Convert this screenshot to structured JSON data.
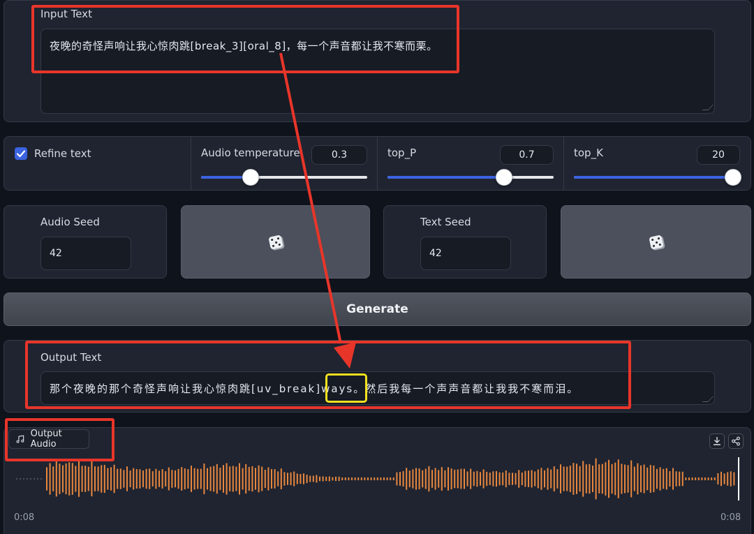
{
  "input": {
    "label": "Input Text",
    "value": "夜晚的奇怪声响让我心惊肉跳[break_3][oral_8]，每一个声音都让我不寒而栗。"
  },
  "controls": {
    "refine": {
      "label": "Refine text",
      "checked": true
    },
    "audio_temperature": {
      "label": "Audio temperature",
      "value": "0.3",
      "fraction": 0.3
    },
    "top_p": {
      "label": "top_P",
      "value": "0.7",
      "fraction": 0.7
    },
    "top_k": {
      "label": "top_K",
      "value": "20",
      "fraction": 1.0
    }
  },
  "seeds": {
    "audio": {
      "label": "Audio Seed",
      "value": "42"
    },
    "text": {
      "label": "Text Seed",
      "value": "42"
    }
  },
  "generate_label": "Generate",
  "output": {
    "label": "Output Text",
    "before": "那个夜晚的那个奇怪声响让我心惊肉跳[uv_brea",
    "highlight": "k]ways",
    "after": "。然后我每一个声声音都让我我不寒而泪。"
  },
  "audio": {
    "label": "Output Audio",
    "time_start": "0:08",
    "time_end": "0:08"
  },
  "colors": {
    "accent": "#3b63e0",
    "annotation_red": "#e8352a",
    "annotation_yellow": "#f5e11f",
    "waveform": "#e8873f"
  },
  "icons": {
    "checkbox": "check-icon",
    "dice": "dice-icon",
    "music": "music-note-icon",
    "download": "download-icon",
    "share": "share-icon"
  }
}
